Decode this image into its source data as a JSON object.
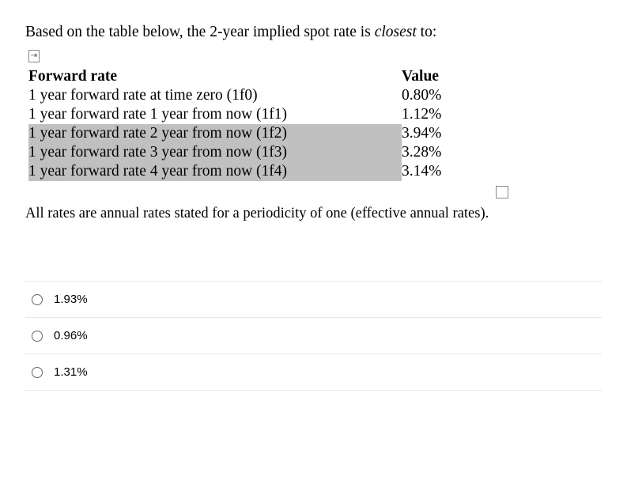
{
  "question": {
    "prefix": "Based on the table below, the 2-year implied spot rate is ",
    "italic": "closest",
    "suffix": " to:"
  },
  "table": {
    "headers": {
      "rate": "Forward rate",
      "value": "Value"
    },
    "rows": [
      {
        "label": "1 year forward rate at time zero (1f0)",
        "value": "0.80%",
        "highlight": false
      },
      {
        "label": "1 year forward rate 1 year from now (1f1)",
        "value": "1.12%",
        "highlight": false
      },
      {
        "label": "1 year forward rate 2 year from now (1f2)",
        "value": "3.94%",
        "highlight": true
      },
      {
        "label": "1 year forward rate 3 year from now (1f3)",
        "value": "3.28%",
        "highlight": true
      },
      {
        "label": "1 year forward rate 4 year from now (1f4)",
        "value": "3.14%",
        "highlight": true
      }
    ]
  },
  "footnote": "All rates are annual rates stated for a periodicity of one (effective annual rates).",
  "options": [
    {
      "label": "1.93%"
    },
    {
      "label": "0.96%"
    },
    {
      "label": "1.31%"
    }
  ],
  "td_glyph": "⇥"
}
